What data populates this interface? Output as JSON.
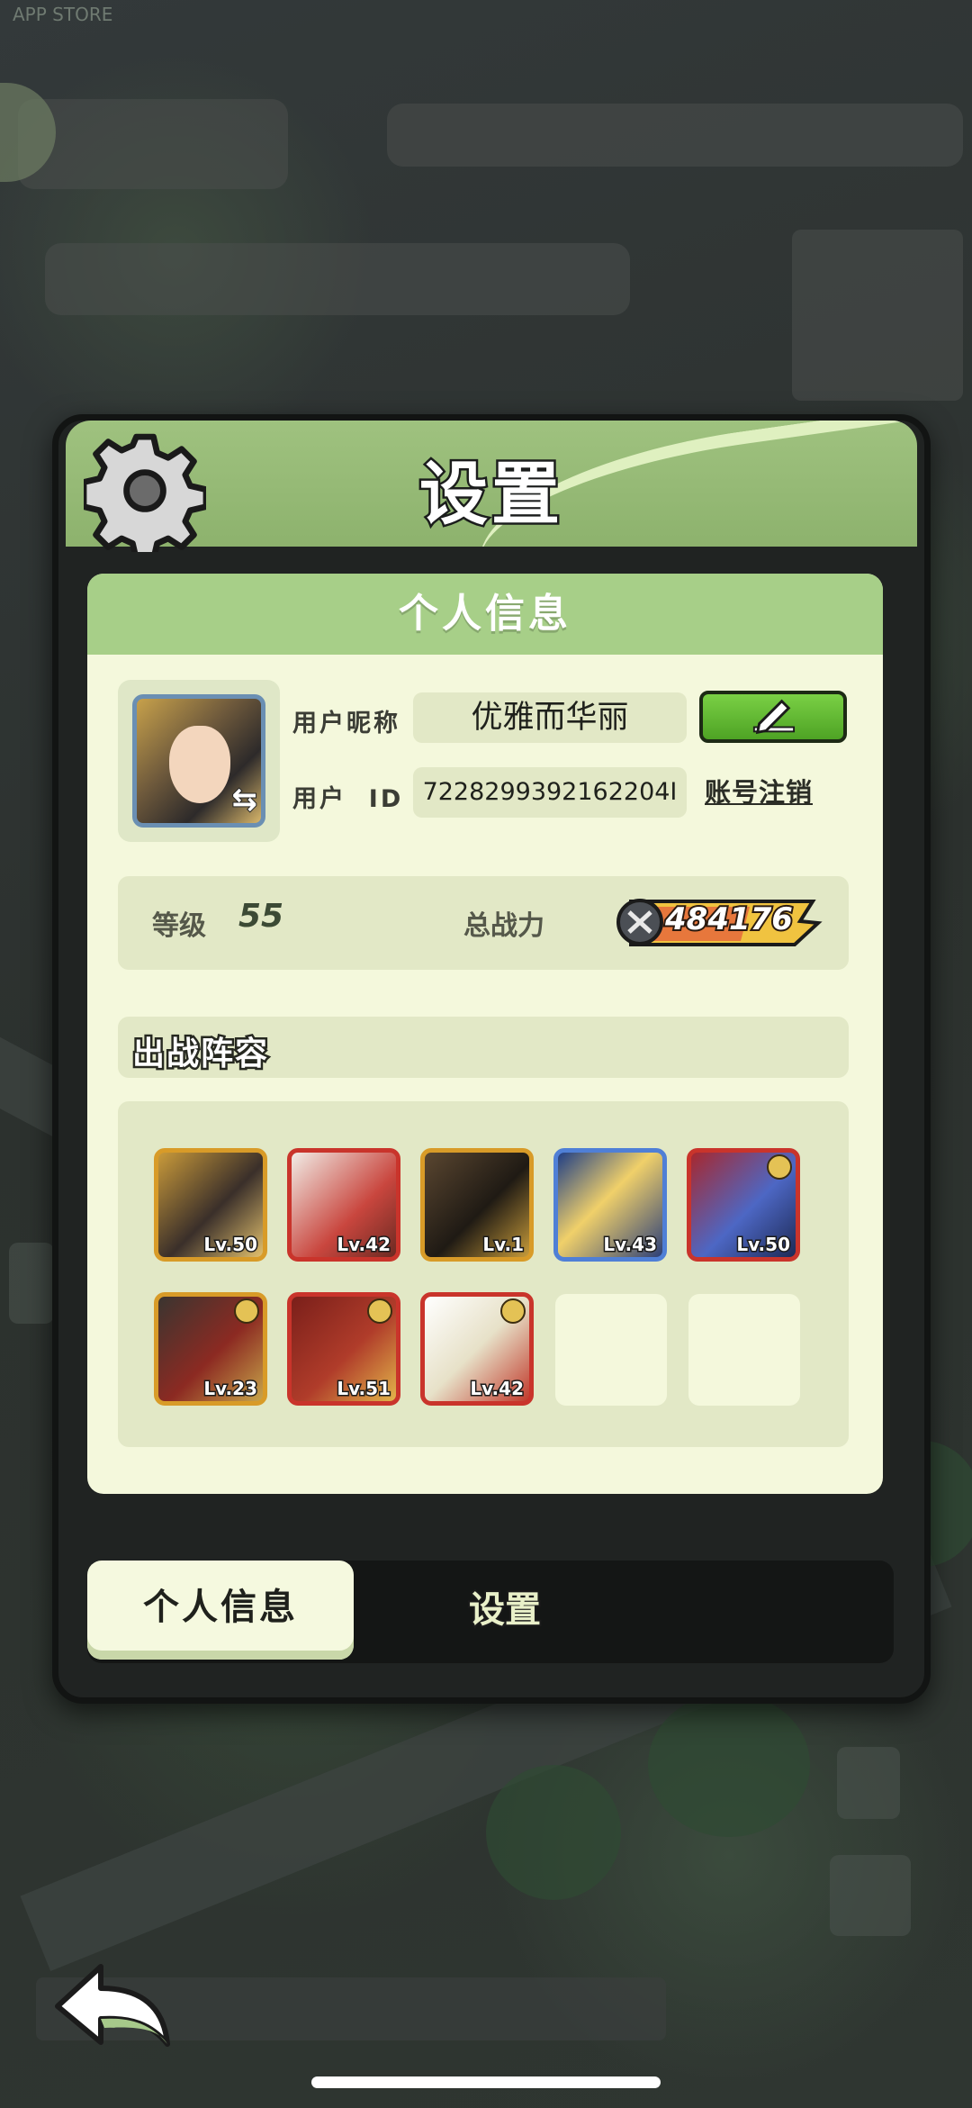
{
  "status": {
    "carrier_text": "APP STORE"
  },
  "panel": {
    "title": "设置"
  },
  "personal_info": {
    "section_title": "个人信息",
    "nickname_label": "用户昵称",
    "nickname": "优雅而华丽",
    "uid_label": "用户  ID",
    "uid": "7228299392162204I",
    "account_cancel_label": "账号注销",
    "level_label": "等级",
    "level": "55",
    "power_label": "总战力",
    "power": "484176"
  },
  "lineup": {
    "title": "出战阵容",
    "heroes": [
      {
        "level": "Lv.50",
        "frame": "#d89b28"
      },
      {
        "level": "Lv.42",
        "frame": "#c9342b"
      },
      {
        "level": "Lv.1",
        "frame": "#d89b28"
      },
      {
        "level": "Lv.43",
        "frame": "#4f7fd6"
      },
      {
        "level": "Lv.50",
        "frame": "#c9342b"
      },
      {
        "level": "Lv.23",
        "frame": "#d89b28"
      },
      {
        "level": "Lv.51",
        "frame": "#c9342b"
      },
      {
        "level": "Lv.42",
        "frame": "#c9342b"
      }
    ]
  },
  "tabs": [
    {
      "label": "个人信息",
      "active": true
    },
    {
      "label": "设置",
      "active": false
    }
  ],
  "colors": {
    "header_green": "#9fc27f",
    "content_bg": "#f4f8dc",
    "edit_button_green": "#5fb832",
    "power_gold": "#f0c340"
  }
}
